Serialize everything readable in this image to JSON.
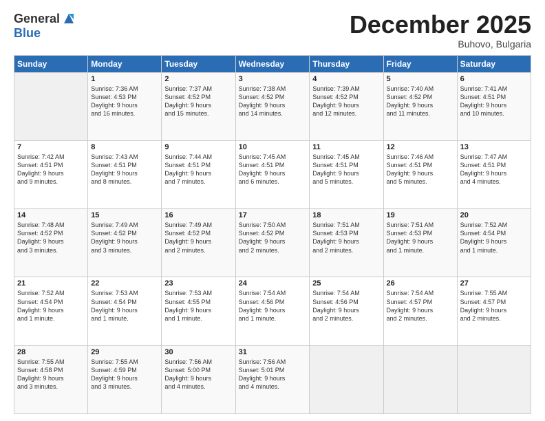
{
  "logo": {
    "general": "General",
    "blue": "Blue"
  },
  "header": {
    "month": "December 2025",
    "location": "Buhovo, Bulgaria"
  },
  "weekdays": [
    "Sunday",
    "Monday",
    "Tuesday",
    "Wednesday",
    "Thursday",
    "Friday",
    "Saturday"
  ],
  "weeks": [
    [
      {
        "day": "",
        "info": ""
      },
      {
        "day": "1",
        "info": "Sunrise: 7:36 AM\nSunset: 4:53 PM\nDaylight: 9 hours\nand 16 minutes."
      },
      {
        "day": "2",
        "info": "Sunrise: 7:37 AM\nSunset: 4:52 PM\nDaylight: 9 hours\nand 15 minutes."
      },
      {
        "day": "3",
        "info": "Sunrise: 7:38 AM\nSunset: 4:52 PM\nDaylight: 9 hours\nand 14 minutes."
      },
      {
        "day": "4",
        "info": "Sunrise: 7:39 AM\nSunset: 4:52 PM\nDaylight: 9 hours\nand 12 minutes."
      },
      {
        "day": "5",
        "info": "Sunrise: 7:40 AM\nSunset: 4:52 PM\nDaylight: 9 hours\nand 11 minutes."
      },
      {
        "day": "6",
        "info": "Sunrise: 7:41 AM\nSunset: 4:51 PM\nDaylight: 9 hours\nand 10 minutes."
      }
    ],
    [
      {
        "day": "7",
        "info": "Sunrise: 7:42 AM\nSunset: 4:51 PM\nDaylight: 9 hours\nand 9 minutes."
      },
      {
        "day": "8",
        "info": "Sunrise: 7:43 AM\nSunset: 4:51 PM\nDaylight: 9 hours\nand 8 minutes."
      },
      {
        "day": "9",
        "info": "Sunrise: 7:44 AM\nSunset: 4:51 PM\nDaylight: 9 hours\nand 7 minutes."
      },
      {
        "day": "10",
        "info": "Sunrise: 7:45 AM\nSunset: 4:51 PM\nDaylight: 9 hours\nand 6 minutes."
      },
      {
        "day": "11",
        "info": "Sunrise: 7:45 AM\nSunset: 4:51 PM\nDaylight: 9 hours\nand 5 minutes."
      },
      {
        "day": "12",
        "info": "Sunrise: 7:46 AM\nSunset: 4:51 PM\nDaylight: 9 hours\nand 5 minutes."
      },
      {
        "day": "13",
        "info": "Sunrise: 7:47 AM\nSunset: 4:51 PM\nDaylight: 9 hours\nand 4 minutes."
      }
    ],
    [
      {
        "day": "14",
        "info": "Sunrise: 7:48 AM\nSunset: 4:52 PM\nDaylight: 9 hours\nand 3 minutes."
      },
      {
        "day": "15",
        "info": "Sunrise: 7:49 AM\nSunset: 4:52 PM\nDaylight: 9 hours\nand 3 minutes."
      },
      {
        "day": "16",
        "info": "Sunrise: 7:49 AM\nSunset: 4:52 PM\nDaylight: 9 hours\nand 2 minutes."
      },
      {
        "day": "17",
        "info": "Sunrise: 7:50 AM\nSunset: 4:52 PM\nDaylight: 9 hours\nand 2 minutes."
      },
      {
        "day": "18",
        "info": "Sunrise: 7:51 AM\nSunset: 4:53 PM\nDaylight: 9 hours\nand 2 minutes."
      },
      {
        "day": "19",
        "info": "Sunrise: 7:51 AM\nSunset: 4:53 PM\nDaylight: 9 hours\nand 1 minute."
      },
      {
        "day": "20",
        "info": "Sunrise: 7:52 AM\nSunset: 4:54 PM\nDaylight: 9 hours\nand 1 minute."
      }
    ],
    [
      {
        "day": "21",
        "info": "Sunrise: 7:52 AM\nSunset: 4:54 PM\nDaylight: 9 hours\nand 1 minute."
      },
      {
        "day": "22",
        "info": "Sunrise: 7:53 AM\nSunset: 4:54 PM\nDaylight: 9 hours\nand 1 minute."
      },
      {
        "day": "23",
        "info": "Sunrise: 7:53 AM\nSunset: 4:55 PM\nDaylight: 9 hours\nand 1 minute."
      },
      {
        "day": "24",
        "info": "Sunrise: 7:54 AM\nSunset: 4:56 PM\nDaylight: 9 hours\nand 1 minute."
      },
      {
        "day": "25",
        "info": "Sunrise: 7:54 AM\nSunset: 4:56 PM\nDaylight: 9 hours\nand 2 minutes."
      },
      {
        "day": "26",
        "info": "Sunrise: 7:54 AM\nSunset: 4:57 PM\nDaylight: 9 hours\nand 2 minutes."
      },
      {
        "day": "27",
        "info": "Sunrise: 7:55 AM\nSunset: 4:57 PM\nDaylight: 9 hours\nand 2 minutes."
      }
    ],
    [
      {
        "day": "28",
        "info": "Sunrise: 7:55 AM\nSunset: 4:58 PM\nDaylight: 9 hours\nand 3 minutes."
      },
      {
        "day": "29",
        "info": "Sunrise: 7:55 AM\nSunset: 4:59 PM\nDaylight: 9 hours\nand 3 minutes."
      },
      {
        "day": "30",
        "info": "Sunrise: 7:56 AM\nSunset: 5:00 PM\nDaylight: 9 hours\nand 4 minutes."
      },
      {
        "day": "31",
        "info": "Sunrise: 7:56 AM\nSunset: 5:01 PM\nDaylight: 9 hours\nand 4 minutes."
      },
      {
        "day": "",
        "info": ""
      },
      {
        "day": "",
        "info": ""
      },
      {
        "day": "",
        "info": ""
      }
    ]
  ]
}
